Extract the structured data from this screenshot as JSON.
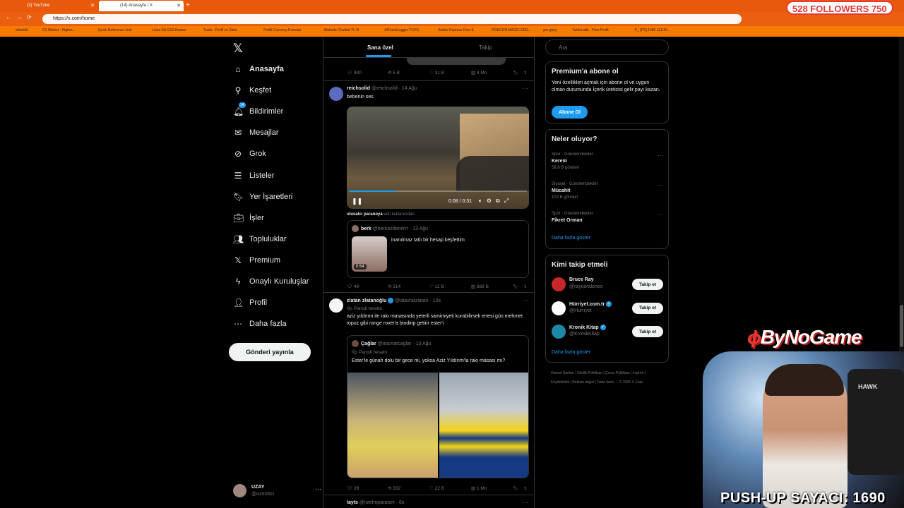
{
  "browser": {
    "tabs": [
      {
        "label": "(3) YouTube"
      },
      {
        "label": "(14) Anasayfa / X"
      }
    ],
    "url": "https://x.com/home",
    "bookmarks": [
      "skinclub",
      "CS Market - Higher...",
      "Quick Reference Link",
      "Lotus SA CSS Hosten",
      "Trade - Perfil ve Slots",
      "Profit Currency Formats",
      "Website Chatbot Tf, III",
      "AICrackLogger TV/IIS",
      "Adobe Express Free &",
      "PGECON MAGIC ENG...",
      "pro glory",
      "Twitch.ads - Poor Profit",
      "P_ [PS] 1080 LEGIO..."
    ],
    "followers_overlay": "528 FOLLOWERS 750"
  },
  "sidebar": {
    "items": [
      {
        "label": "Anasayfa",
        "icon": "home-icon",
        "glyph": "⌂"
      },
      {
        "label": "Keşfet",
        "icon": "search-icon",
        "glyph": "⚲"
      },
      {
        "label": "Bildirimler",
        "icon": "bell-icon",
        "glyph": "🔔︎"
      },
      {
        "label": "Mesajlar",
        "icon": "mail-icon",
        "glyph": "✉"
      },
      {
        "label": "Grok",
        "icon": "grok-icon",
        "glyph": "⊘"
      },
      {
        "label": "Listeler",
        "icon": "list-icon",
        "glyph": "☰"
      },
      {
        "label": "Yer İşaretleri",
        "icon": "bookmark-icon",
        "glyph": "🔖︎"
      },
      {
        "label": "İşler",
        "icon": "briefcase-icon",
        "glyph": "💼︎"
      },
      {
        "label": "Topluluklar",
        "icon": "communities-icon",
        "glyph": "👥︎"
      },
      {
        "label": "Premium",
        "icon": "x-premium-icon",
        "glyph": "𝕏"
      },
      {
        "label": "Onaylı Kuruluşlar",
        "icon": "lightning-icon",
        "glyph": "ϟ"
      },
      {
        "label": "Profil",
        "icon": "person-icon",
        "glyph": "👤︎"
      },
      {
        "label": "Daha fazla",
        "icon": "more-circle-icon",
        "glyph": "⋯"
      }
    ],
    "notification_count": "14",
    "post_button": "Gönderi yayınla",
    "profile_name": "UZAY",
    "profile_handle": "@uzm00n"
  },
  "feed": {
    "tabs": [
      "Sana özel",
      "Takip"
    ],
    "tweet0_actions": {
      "replies": "480",
      "retweets": "5 B",
      "likes": "31 B",
      "views": "4 Mn"
    },
    "tweet1": {
      "name": "reichsolid",
      "handle": "@reichsolid · 14 Ağu",
      "text": "bebenin ses",
      "video_time": "0:08 / 0:31",
      "video_progress": 0.26,
      "caption_user": "ulusalcı paranoya",
      "caption_rest": " adlı kullanıcıdan",
      "quote_name": "berk",
      "quote_handle": "@berkozdemlrrr · 13 Ağu",
      "quote_text": "inanılmaz tatlı bir hesap keşfettim",
      "quote_duration": "0:54",
      "replies": "49",
      "retweets": "314",
      "likes": "11 B",
      "views": "889 B"
    },
    "tweet2": {
      "name": "zlatan zlatanoğlu",
      "handle": "@atavratzlatan · 10s",
      "parody": "Parodi hesabı",
      "text": "aziz yıldırım ile rakı masasında yeterli samimiyeti kurabilirsek ertesi gün mehmet topuz gibi range rover'a bindirip getirir ester'i",
      "quote_name": "Çağlar",
      "quote_handle": "@atavratcaglar · 13 Ağu",
      "quote_parody": "Parodi hesabı",
      "quote_text": "Ester'le günah dolu bir gece mi, yoksa Aziz Yıldırım'la rakı masası mı?",
      "replies": "28",
      "retweets": "332",
      "likes": "22 B",
      "views": "1 Mn"
    },
    "tweet3": {
      "name": "layts",
      "handle": "@istelmparatorr · 6s"
    }
  },
  "right": {
    "search_placeholder": "Ara",
    "premium_title": "Premium'a abone ol",
    "premium_text": "Yeni özellikleri açmak için abone ol ve uygun olman durumunda İçerik üreticisi gelir payı kazan.",
    "premium_button": "Abone Ol",
    "trends_title": "Neler oluyor?",
    "trends": [
      {
        "category": "Spor · Gündemdekiler",
        "title": "Kerem",
        "count": "59,6 B gönderi"
      },
      {
        "category": "Siyaset · Gündemdekiler",
        "title": "Mücahit",
        "count": "102 B gönderi"
      },
      {
        "category": "Spor · Gündemdekiler",
        "title": "Fikret Orman",
        "count": ""
      }
    ],
    "show_more": "Daha fazla göster",
    "wtf_title": "Kimi takip etmeli",
    "wtf": [
      {
        "name": "Bruce Ray",
        "handle": "@raycondones",
        "verified": false,
        "color": "#c62828"
      },
      {
        "name": "Hürriyet.com.tr",
        "handle": "@Hurriyet",
        "verified": true,
        "color": "#ffffff"
      },
      {
        "name": "Kronik Kitap",
        "handle": "@KronikKitap",
        "verified": true,
        "color": "#1e88a8"
      }
    ],
    "follow_label": "Takip et",
    "footer": "Hizmet Şartları | Gizlilik Politikası | Çerez Politikası | İmprint | Erişilebilirlik | Reklam bilgisi | Daha fazla ··· © 2025 X Corp."
  },
  "overlay": {
    "brand": "ByNoGame",
    "chair_label": "HAWK",
    "pushups": "PUSH-UP SAYACI: 1690"
  },
  "colors": {
    "accent": "#1d9bf0",
    "browser_orange": "#e8590c"
  }
}
